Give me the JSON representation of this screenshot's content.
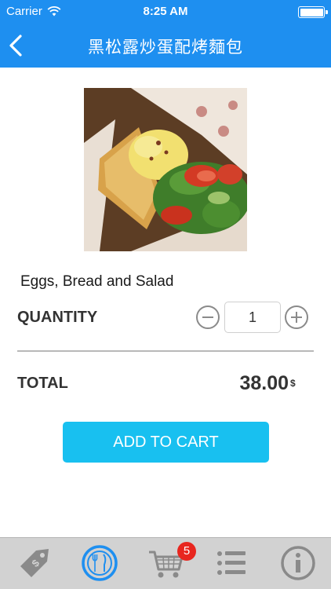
{
  "status_bar": {
    "carrier": "Carrier",
    "time": "8:25 AM"
  },
  "nav": {
    "title": "黑松露炒蛋配烤麵包",
    "back_icon": "chevron-left-icon"
  },
  "product": {
    "image_icon": "food-photo",
    "name": "Eggs, Bread and Salad"
  },
  "quantity": {
    "label": "QUANTITY",
    "value": "1"
  },
  "total": {
    "label": "TOTAL",
    "value": "38.00",
    "currency": "$"
  },
  "actions": {
    "add_to_cart": "ADD TO CART"
  },
  "tab_bar": {
    "items": [
      {
        "icon": "price-tag-icon",
        "active": false
      },
      {
        "icon": "fork-knife-icon",
        "active": true
      },
      {
        "icon": "cart-icon",
        "active": false
      },
      {
        "icon": "list-icon",
        "active": false
      },
      {
        "icon": "info-icon",
        "active": false
      }
    ],
    "cart_badge": "5"
  },
  "colors": {
    "primary": "#1e8ff0",
    "button": "#18c0f0",
    "badge": "#e8261f",
    "tabbar": "#d2d2d2"
  }
}
